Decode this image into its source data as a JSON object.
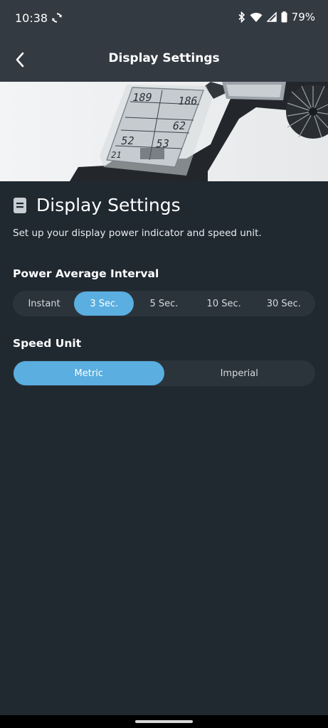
{
  "status_bar": {
    "time": "10:38",
    "battery": "79%",
    "icons": [
      "sync-icon",
      "bluetooth-icon",
      "wifi-icon",
      "cell-signal-icon",
      "battery-icon"
    ]
  },
  "app_bar": {
    "title": "Display Settings",
    "back_icon": "chevron-left-icon"
  },
  "hero": {
    "display_readouts": [
      "189",
      "186",
      "62",
      "52",
      "53",
      "21"
    ]
  },
  "section": {
    "icon": "document-icon",
    "title": "Display Settings",
    "description": "Set up your display power indicator and speed unit."
  },
  "power_average": {
    "label": "Power Average Interval",
    "options": [
      "Instant",
      "3 Sec.",
      "5 Sec.",
      "10 Sec.",
      "30 Sec."
    ],
    "selected": "3 Sec."
  },
  "speed_unit": {
    "label": "Speed Unit",
    "options": [
      "Metric",
      "Imperial"
    ],
    "selected": "Metric"
  },
  "colors": {
    "accent": "#5aaee0",
    "background": "#202830",
    "app_bar": "#333a42",
    "segment_bg": "#2b333b"
  }
}
